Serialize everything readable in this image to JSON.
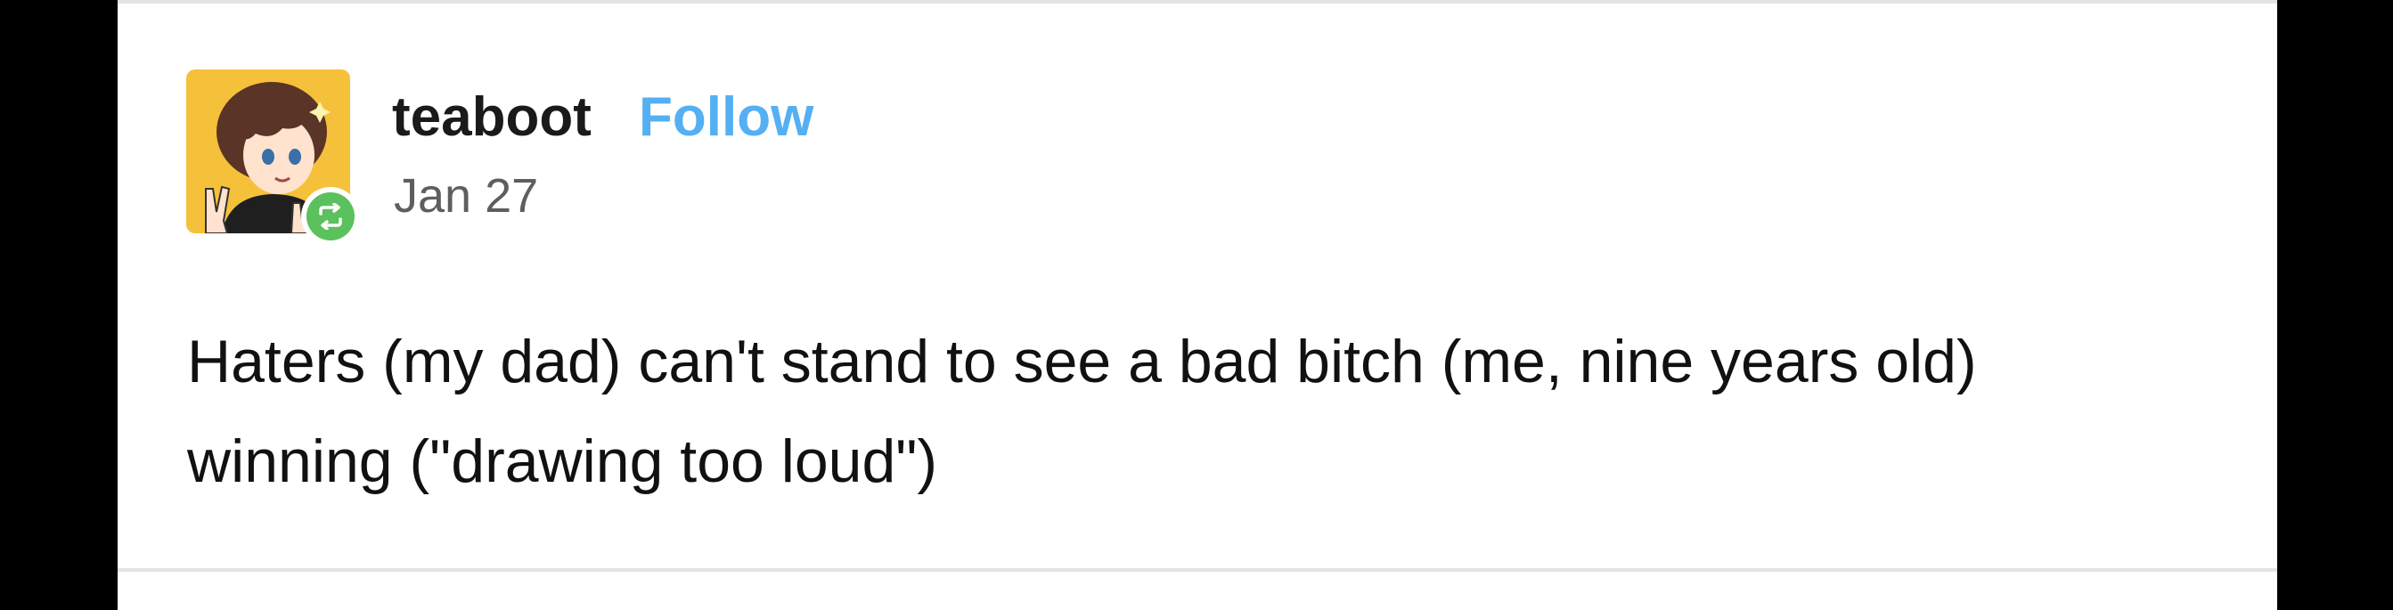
{
  "post": {
    "author": {
      "username": "teaboot",
      "follow_label": "Follow",
      "avatar_icon": "anime-girl-avatar",
      "reblog_badge_icon": "reblog-icon"
    },
    "date": "Jan 27",
    "body_lines": [
      "Haters (my dad) can't stand to see a bad bitch (me, nine years old)",
      "winning (\"drawing too loud\")"
    ]
  },
  "colors": {
    "follow": "#54b0f2",
    "reblog_badge": "#5ac15d",
    "avatar_background": "#f6c13a",
    "card_background": "#ffffff",
    "frame": "#000000"
  }
}
